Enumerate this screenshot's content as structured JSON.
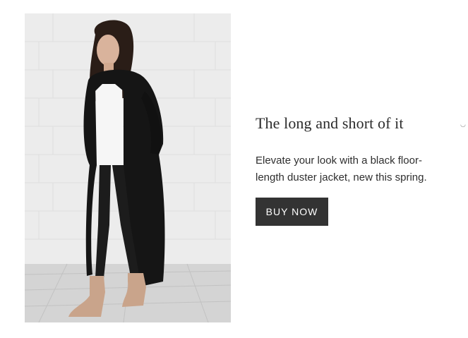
{
  "feature": {
    "headline": "The long and short of it",
    "description": "Elevate your look with a black floor-length duster jacket, new this spring.",
    "button_label": "BUY NOW",
    "image_icon": "product-photo-woman-in-black-duster"
  },
  "colors": {
    "button_bg": "#333333",
    "button_text": "#ffffff",
    "headline": "#2b2b2b",
    "body_text": "#2f2f2f"
  }
}
